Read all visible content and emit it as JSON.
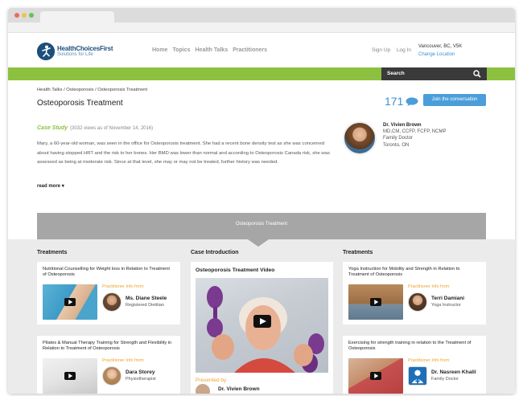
{
  "brand": {
    "name": "HealthChoicesFirst",
    "tagline": "Solutions for Life"
  },
  "nav": {
    "items": [
      "Home",
      "Topics",
      "Health Talks",
      "Practitioners"
    ]
  },
  "auth": {
    "sign_up": "Sign Up",
    "log_in": "Log In"
  },
  "location": {
    "city": "Vancouver, BC, V5K",
    "change": "Change Location"
  },
  "search": {
    "label": "Search"
  },
  "breadcrumb": {
    "text": "Health Talks  /  Osteoporosis  /  Osteoporosis Treatment"
  },
  "page": {
    "title": "Osteoporosis Treatment",
    "comment_count": "171",
    "join_label": "Join the conversation"
  },
  "case": {
    "label": "Case Study",
    "meta": "(3032 views as of November 14, 2016)",
    "body": "Mary, a 60-year-old woman, was seen in the office for Osteoporosis treatment. She had a recent bone density test as she was concerned about having stopped HRT and the risk to her bones. Her BMD was lower than normal and according to Osteoporosis Canada risk, she was assessed as being at moderate risk. Since at that level, she may or may not be treated, further history was needed.",
    "read_more": "read more"
  },
  "author": {
    "name": "Dr. Vivien Brown",
    "credentials": "MD,CM, CCFP, FCFP, NCMP",
    "role": "Family Doctor",
    "city": "Toronto, ON"
  },
  "banner": {
    "text": "Osteoporosis Treatment"
  },
  "columns": {
    "left_heading": "Treatments",
    "center_heading": "Case Introduction",
    "right_heading": "Treatments"
  },
  "cards": {
    "left": [
      {
        "title": "Nutritional Counselling for Weight loss in Relation to Treatment of Osteoporosis",
        "practitioner_label": "Practitioner Info from:",
        "name": "Ms. Diane Steele",
        "role": "Registered Dietitian"
      },
      {
        "title": "Pilates & Manual Therapy Training for Strength and Flexibility in Relation to Treatment of Osteoporosis",
        "practitioner_label": "Practitioner Info from:",
        "name": "Dara Storey",
        "role": "Physiotherapist"
      }
    ],
    "right": [
      {
        "title": "Yoga Instruction for Mobility and Strength in Relation to Treatment of Osteoporosis",
        "practitioner_label": "Practitioner Info from:",
        "name": "Terri Damiani",
        "role": "Yoga Instructor"
      },
      {
        "title": "Exercising for strength training in relation to the Treatment of Osteoporosis",
        "practitioner_label": "Practitioner Info from:",
        "name": "Dr. Nasreen Khalil",
        "role": "Family Doctor"
      }
    ]
  },
  "video": {
    "title": "Osteoporosis Treatment Video",
    "presented_by": "Presented by",
    "presenter": "Dr. Vivien Brown"
  },
  "colors": {
    "green": "#8cc13f",
    "blue": "#4a9ed9",
    "orange": "#f0a12a",
    "navy": "#1d4f7c"
  }
}
